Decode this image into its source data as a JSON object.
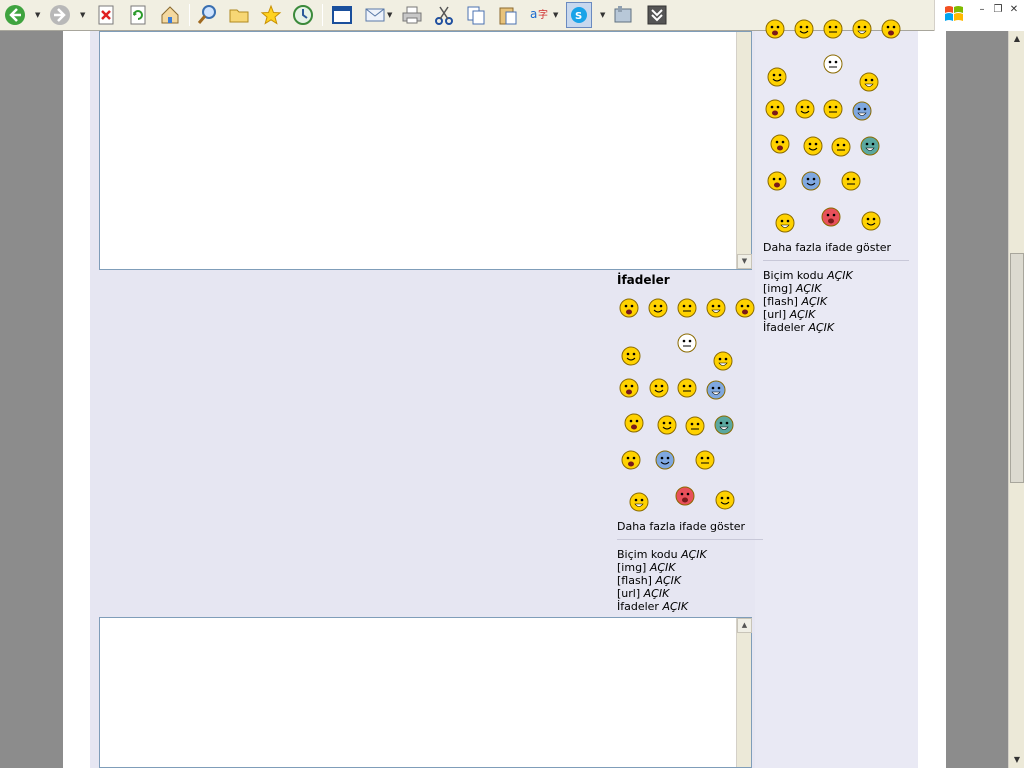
{
  "toolbar": {
    "buttons": [
      {
        "name": "back-button",
        "icon": "back-arrow-icon"
      },
      {
        "name": "forward-button",
        "icon": "forward-arrow-icon"
      },
      {
        "name": "stop-button",
        "icon": "stop-icon"
      },
      {
        "name": "refresh-button",
        "icon": "refresh-icon"
      },
      {
        "name": "home-button",
        "icon": "home-icon"
      },
      {
        "name": "search-button",
        "icon": "search-icon"
      },
      {
        "name": "folders-button",
        "icon": "folder-icon"
      },
      {
        "name": "favorites-button",
        "icon": "star-icon"
      },
      {
        "name": "history-button",
        "icon": "history-icon"
      },
      {
        "name": "fullscreen-button",
        "icon": "window-icon"
      },
      {
        "name": "mail-button",
        "icon": "mail-icon"
      },
      {
        "name": "print-button",
        "icon": "printer-icon"
      },
      {
        "name": "cut-button",
        "icon": "scissors-icon"
      },
      {
        "name": "copy-button",
        "icon": "copy-icon"
      },
      {
        "name": "paste-button",
        "icon": "paste-icon"
      },
      {
        "name": "encoding-button",
        "icon": "encoding-icon"
      },
      {
        "name": "skype-button",
        "icon": "skype-icon"
      },
      {
        "name": "tools-button",
        "icon": "tools-icon"
      },
      {
        "name": "more-button",
        "icon": "chevron-double-down-icon"
      }
    ]
  },
  "smilies_section": {
    "title": "İfadeler",
    "more_link": "Daha fazla ifade göster"
  },
  "status_lines": [
    {
      "label": "Biçim kodu",
      "value": "AÇIK"
    },
    {
      "label": "[img]",
      "value": "AÇIK"
    },
    {
      "label": "[flash]",
      "value": "AÇIK"
    },
    {
      "label": "[url]",
      "value": "AÇIK"
    },
    {
      "label": "İfadeler",
      "value": "AÇIK"
    }
  ],
  "right_panel": {
    "more_link": "Daha fazla ifade göster",
    "status_lines": [
      {
        "label": "Biçim kodu",
        "value": "AÇIK"
      },
      {
        "label": "[img]",
        "value": "AÇIK"
      },
      {
        "label": "[flash]",
        "value": "AÇIK"
      },
      {
        "label": "[url]",
        "value": "AÇIK"
      },
      {
        "label": "İfadeler",
        "value": "AÇIK"
      }
    ]
  },
  "colors": {
    "panel": "#e6e6f2",
    "smiley_yellow": "#ffd200",
    "smiley_red": "#e8505a",
    "smiley_blue": "#7fa8e0"
  }
}
